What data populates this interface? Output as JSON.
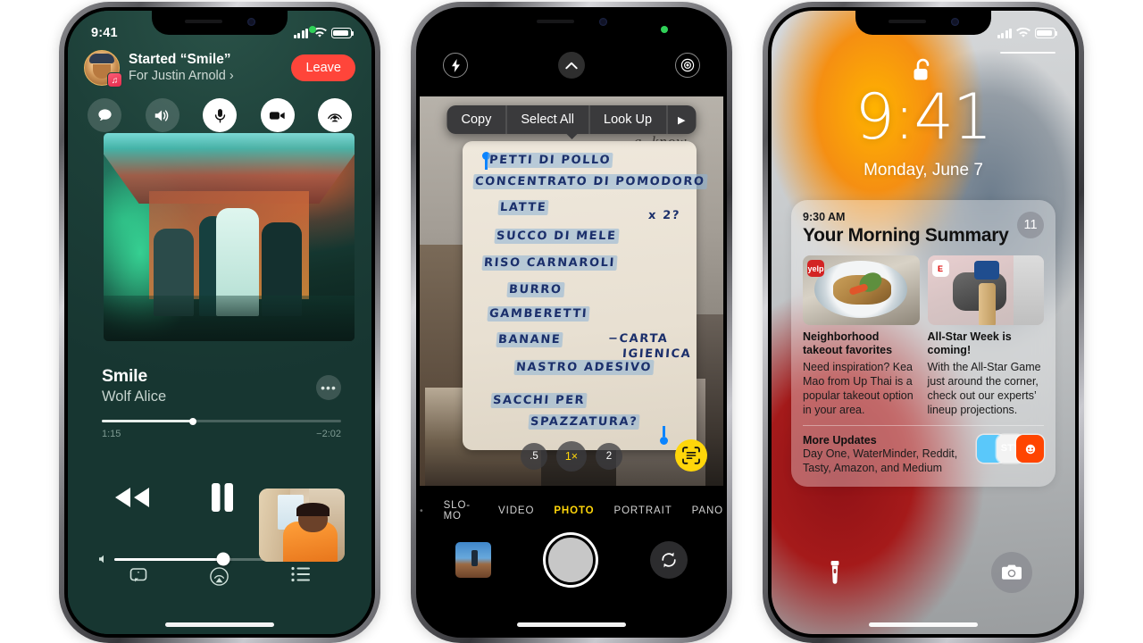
{
  "phone1": {
    "status": {
      "clock": "9:41",
      "signal_icon": "cellular-bars-icon",
      "wifi_icon": "wifi-icon",
      "battery_icon": "battery-icon"
    },
    "shareplay": {
      "title": "Started “Smile”",
      "subtitle": "For Justin Arnold ›",
      "leave_label": "Leave",
      "avatar_name": "participant-avatar",
      "controls": [
        {
          "name": "messages-bubble-icon",
          "style": "dark"
        },
        {
          "name": "speaker-volume-icon",
          "style": "dark"
        },
        {
          "name": "microphone-icon",
          "style": "light"
        },
        {
          "name": "video-camera-icon",
          "style": "light"
        },
        {
          "name": "shareplay-icon",
          "style": "light"
        }
      ]
    },
    "album_art_alt": "band-photo-album-art",
    "now_playing": {
      "track": "Smile",
      "artist": "Wolf Alice",
      "more_label": "•••",
      "elapsed": "1:15",
      "remaining": "−2:02",
      "progress_pct": 38
    },
    "transport": {
      "rewind_icon": "rewind-icon",
      "pause_icon": "pause-icon",
      "pip_label": "facetime-pip-video"
    },
    "volume_pct": 63,
    "tabs": [
      {
        "name": "lyrics-icon"
      },
      {
        "name": "airplay-icon"
      },
      {
        "name": "queue-list-icon"
      }
    ]
  },
  "phone2": {
    "top": {
      "flash_icon": "flash-icon",
      "chevron_icon": "chevron-up-icon",
      "live_photo_icon": "live-photo-icon"
    },
    "context_menu": {
      "items": [
        "Copy",
        "Select All",
        "Look Up"
      ],
      "more_arrow": "▶"
    },
    "note_lines": [
      "PETTI DI POLLO",
      "CONCENTRATO DI POMODORO",
      "LATTE",
      "SUCCO DI MELE",
      "RISO CARNAROLI",
      "BURRO",
      "GAMBERETTI",
      "BANANE",
      "NASTRO ADESIVO",
      "SACCHI PER",
      "SPAZZATURA?"
    ],
    "note_annotations": {
      "x2": "x 2?",
      "carta_line1": "−CARTA",
      "carta_line2": "IGIENICA"
    },
    "zoom_levels": [
      {
        "label": ".5",
        "active": false
      },
      {
        "label": "1×",
        "active": true
      },
      {
        "label": "2",
        "active": false
      }
    ],
    "live_text_icon": "live-text-scan-icon",
    "modes": [
      {
        "label": "SLO-MO",
        "selected": false
      },
      {
        "label": "VIDEO",
        "selected": false
      },
      {
        "label": "PHOTO",
        "selected": true
      },
      {
        "label": "PORTRAIT",
        "selected": false
      },
      {
        "label": "PANO",
        "selected": false
      }
    ],
    "bottom": {
      "thumbnail_name": "photo-roll-thumbnail",
      "shutter_name": "shutter-button",
      "flip_icon": "camera-flip-icon"
    }
  },
  "phone3": {
    "status": {
      "signal_icon": "cellular-bars-icon",
      "wifi_icon": "wifi-icon",
      "battery_icon": "battery-icon"
    },
    "lock_icon": "unlocked-padlock-icon",
    "time": "9:41",
    "date": "Monday, June 7",
    "summary": {
      "time": "9:30 AM",
      "title": "Your Morning Summary",
      "badge": "11",
      "cards": [
        {
          "app_icon": "yelp-icon",
          "app_icon_label": "yelp",
          "image_name": "thai-noodles-photo",
          "headline": "Neighborhood takeout favorites",
          "body": "Need inspiration? Kea Mao from Up Thai is a popular takeout option in your area."
        },
        {
          "app_icon": "espn-icon",
          "app_icon_label": "E",
          "image_name": "baseball-bat-photo",
          "headline": "All-Star Week is coming!",
          "body": "With the All-Star Game just around the corner, check out our experts’ lineup projections."
        }
      ],
      "more": {
        "title": "More Updates",
        "apps": "Day One, WaterMinder, Reddit, Tasty, Amazon, and Medium",
        "icons": [
          {
            "name": "reddit-icon",
            "label": ""
          },
          {
            "name": "tasty-icon",
            "label": "STY"
          },
          {
            "name": "medium-icon",
            "label": ""
          }
        ]
      }
    },
    "bottom": {
      "flashlight_icon": "flashlight-icon",
      "camera_icon": "camera-icon"
    }
  },
  "colors": {
    "music_bg": "#1c4038",
    "leave_red": "#ff453a",
    "camera_yellow": "#ffd60a",
    "selection_blue": "#0a84ff",
    "ink_blue": "#1b2f6b"
  }
}
